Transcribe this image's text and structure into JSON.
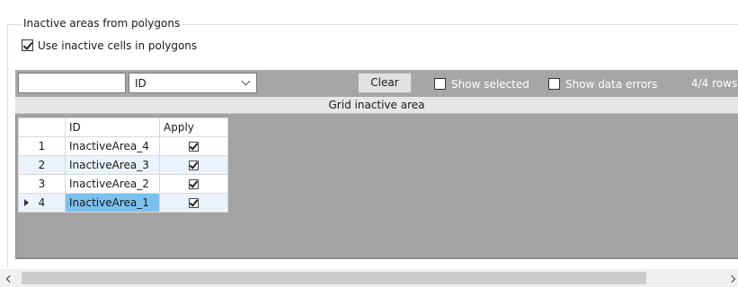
{
  "group": {
    "title": "Inactive areas from polygons",
    "use_inactive_label": "Use inactive cells in polygons",
    "use_inactive_checked": true
  },
  "toolbar": {
    "search_value": "",
    "column_select_value": "ID",
    "clear_label": "Clear",
    "show_selected_label": "Show selected",
    "show_selected_checked": false,
    "show_errors_label": "Show data errors",
    "show_errors_checked": false,
    "rows_count": "4/4 rows"
  },
  "grid": {
    "caption": "Grid inactive area",
    "columns": [
      "",
      "ID",
      "Apply"
    ],
    "rows": [
      {
        "num": "1",
        "id": "InactiveArea_4",
        "apply": true
      },
      {
        "num": "2",
        "id": "InactiveArea_3",
        "apply": true
      },
      {
        "num": "3",
        "id": "InactiveArea_2",
        "apply": true
      },
      {
        "num": "4",
        "id": "InactiveArea_1",
        "apply": true,
        "current": true
      }
    ]
  },
  "colors": {
    "toolbar_bg": "#a6a6a6",
    "grid_bg": "#a3a3a3",
    "selected_cell": "#7cc1ee",
    "alt_row": "#eaf2fb"
  }
}
